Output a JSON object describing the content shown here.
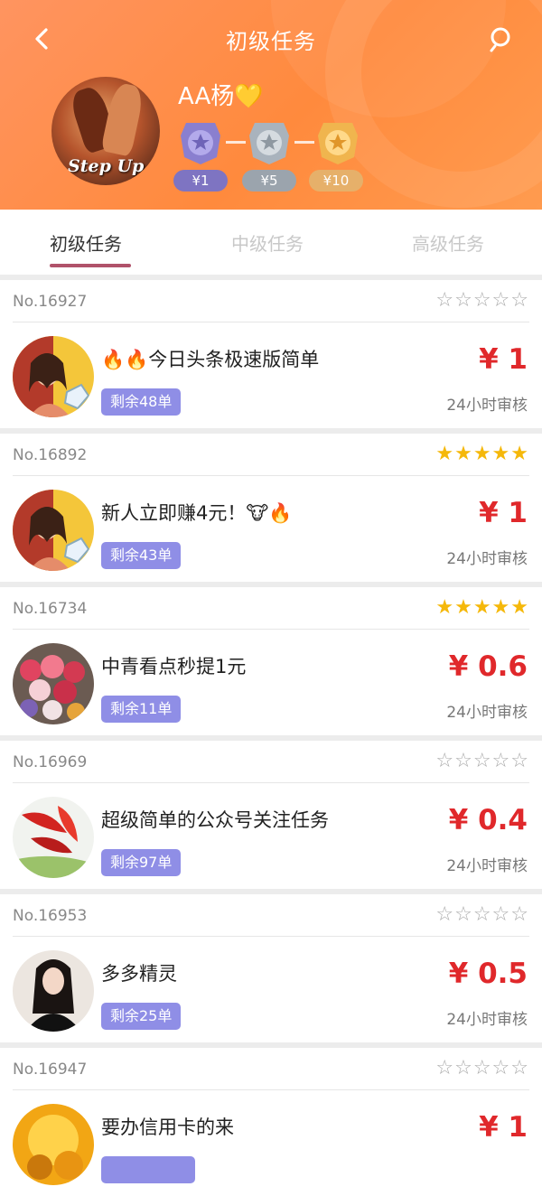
{
  "header": {
    "title": "初级任务",
    "username": "AA杨",
    "heart": "💛",
    "medals": [
      {
        "label": "¥1",
        "color": "#8a7fcf",
        "pill": "#7e74c2"
      },
      {
        "label": "¥5",
        "color": "#a9b3bd",
        "pill": "#9ba4ad"
      },
      {
        "label": "¥10",
        "color": "#f0b54e",
        "pill": "#e6b06a"
      }
    ]
  },
  "tabs": [
    {
      "label": "初级任务",
      "active": true
    },
    {
      "label": "中级任务",
      "active": false
    },
    {
      "label": "高级任务",
      "active": false
    }
  ],
  "tasks": [
    {
      "no": "No.16927",
      "stars": "☆☆☆☆☆",
      "stars_filled": false,
      "name": "🔥🔥今日头条极速版简单",
      "remain": "剩余48单",
      "price": "¥ 1",
      "review": "24小时审核",
      "thumb": "woman"
    },
    {
      "no": "No.16892",
      "stars": "★★★★★",
      "stars_filled": true,
      "name": "新人立即赚4元！🐮🔥",
      "remain": "剩余43单",
      "price": "¥ 1",
      "review": "24小时审核",
      "thumb": "woman"
    },
    {
      "no": "No.16734",
      "stars": "★★★★★",
      "stars_filled": true,
      "name": "中青看点秒提1元",
      "remain": "剩余11单",
      "price": "¥ 0.6",
      "review": "24小时审核",
      "thumb": "flowers"
    },
    {
      "no": "No.16969",
      "stars": "☆☆☆☆☆",
      "stars_filled": false,
      "name": "超级简单的公众号关注任务",
      "remain": "剩余97单",
      "price": "¥ 0.4",
      "review": "24小时审核",
      "thumb": "leaves"
    },
    {
      "no": "No.16953",
      "stars": "☆☆☆☆☆",
      "stars_filled": false,
      "name": "多多精灵",
      "remain": "剩余25单",
      "price": "¥ 0.5",
      "review": "24小时审核",
      "thumb": "girl"
    },
    {
      "no": "No.16947",
      "stars": "☆☆☆☆☆",
      "stars_filled": false,
      "name": "要办信用卡的来",
      "remain": "",
      "price": "¥ 1",
      "review": "",
      "thumb": "gold"
    }
  ],
  "avatar_text": "Step Up"
}
